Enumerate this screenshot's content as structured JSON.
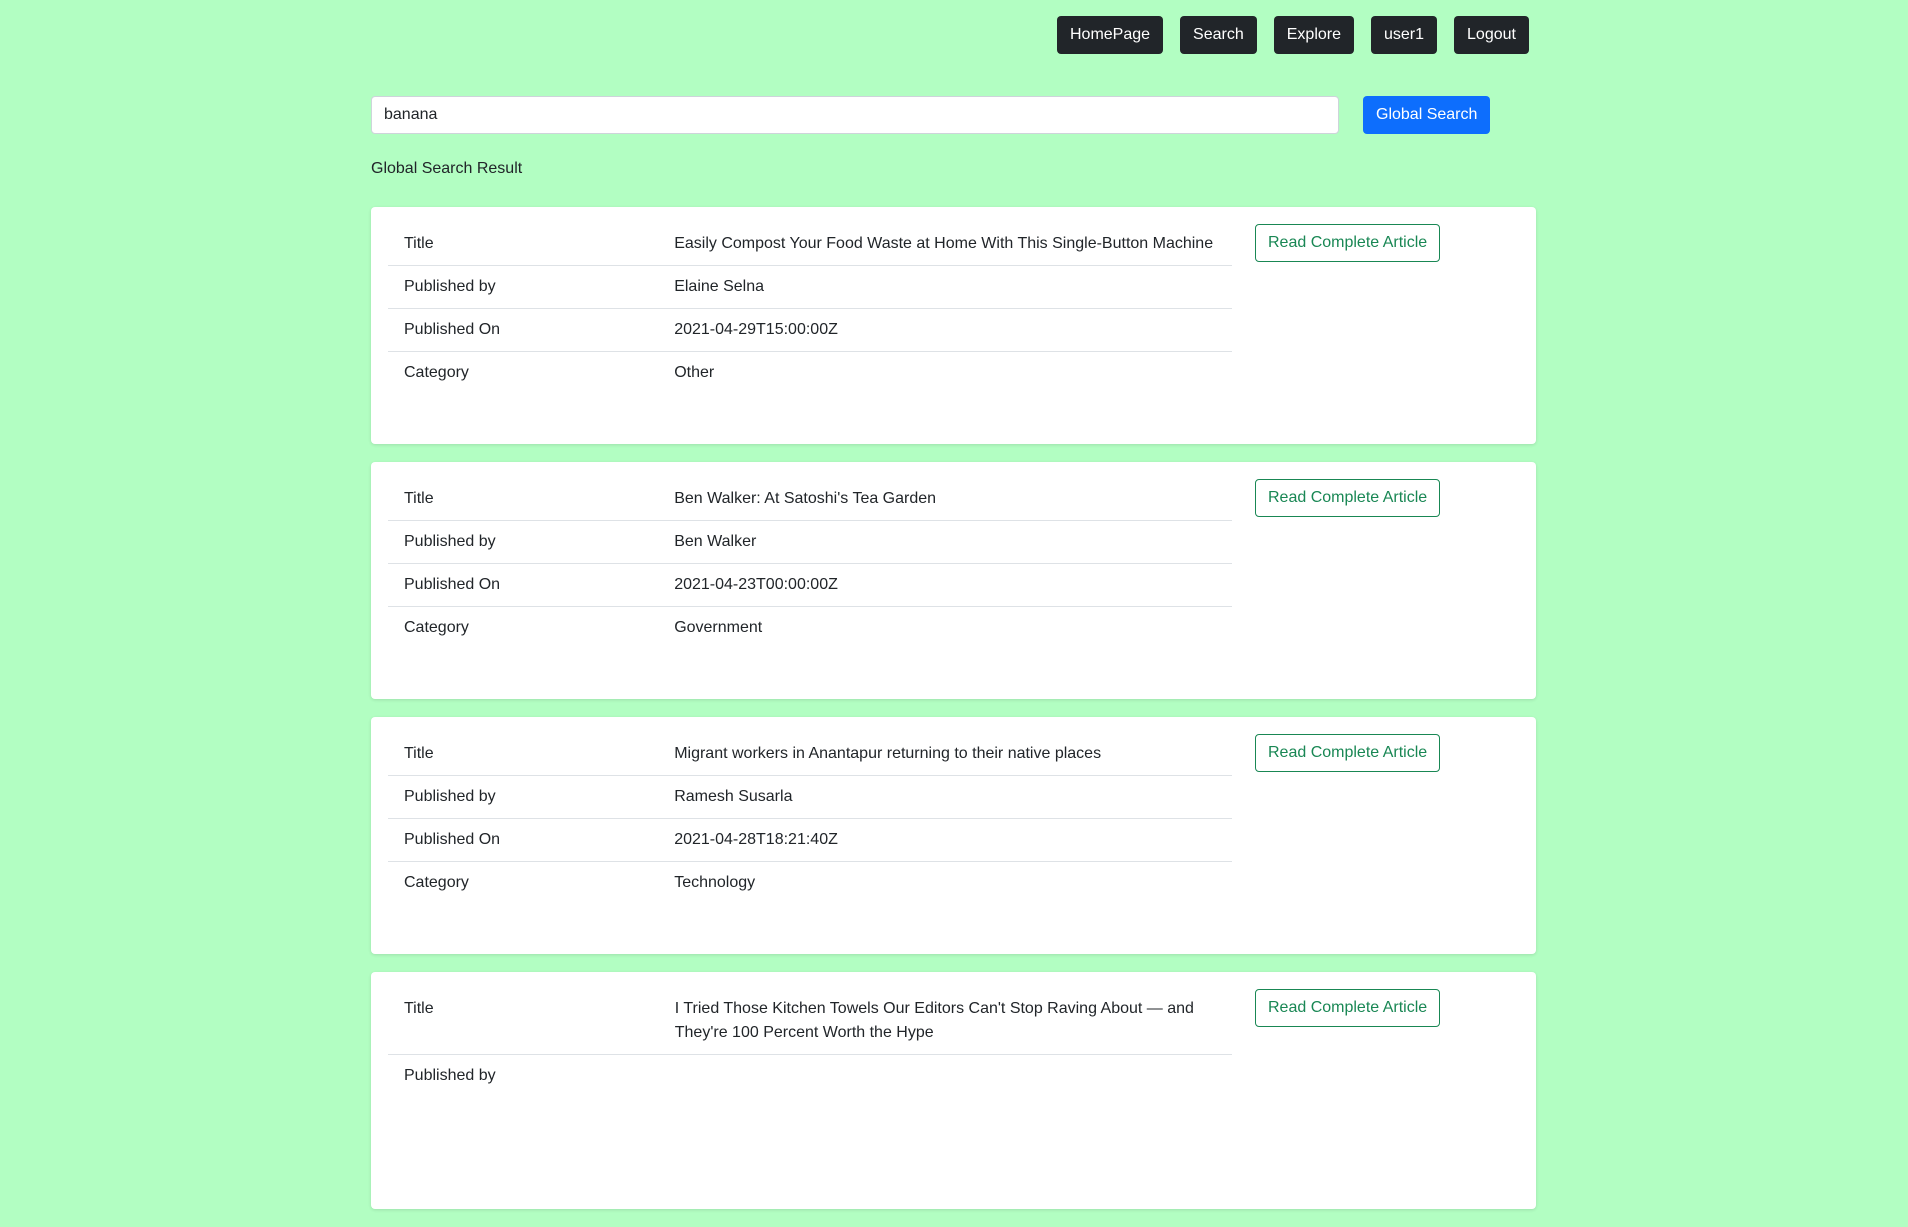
{
  "nav": {
    "homepage": "HomePage",
    "search": "Search",
    "explore": "Explore",
    "user": "user1",
    "logout": "Logout"
  },
  "search": {
    "value": "banana",
    "button": "Global Search"
  },
  "results_heading": "Global Search Result",
  "labels": {
    "title": "Title",
    "published_by": "Published by",
    "published_on": "Published On",
    "category": "Category",
    "read_button": "Read Complete Article"
  },
  "articles": [
    {
      "title": "Easily Compost Your Food Waste at Home With This Single-Button Machine",
      "published_by": "Elaine Selna",
      "published_on": "2021-04-29T15:00:00Z",
      "category": "Other"
    },
    {
      "title": "Ben Walker: At Satoshi's Tea Garden",
      "published_by": "Ben Walker",
      "published_on": "2021-04-23T00:00:00Z",
      "category": "Government"
    },
    {
      "title": "Migrant workers in Anantapur returning to their native places",
      "published_by": "Ramesh Susarla",
      "published_on": "2021-04-28T18:21:40Z",
      "category": "Technology"
    },
    {
      "title": "I Tried Those Kitchen Towels Our Editors Can't Stop Raving About — and They're 100 Percent Worth the Hype",
      "published_by": "",
      "published_on": "",
      "category": ""
    }
  ]
}
